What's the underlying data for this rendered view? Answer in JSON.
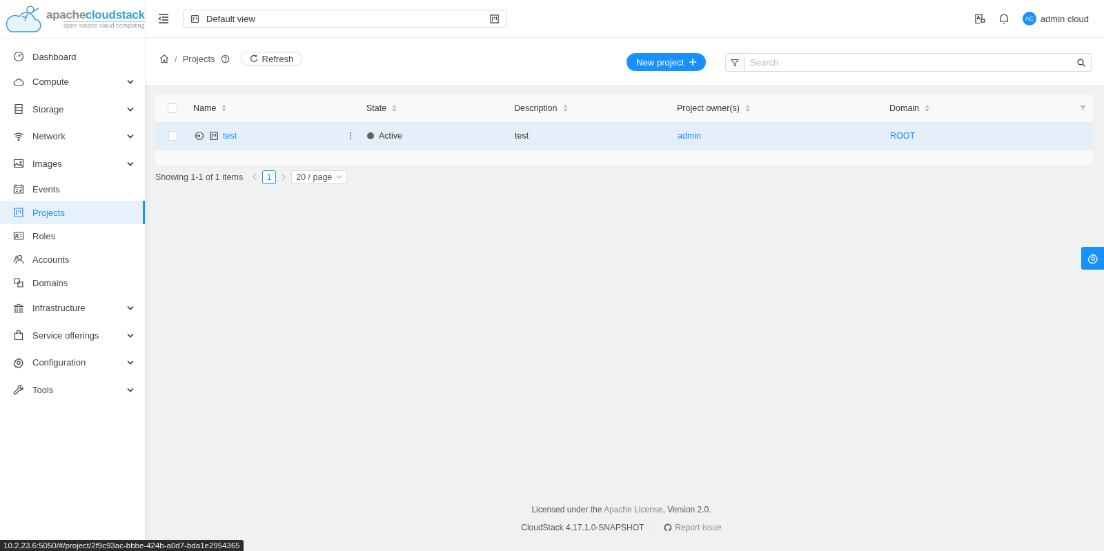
{
  "logo": {
    "prefix": "apache",
    "suffix": "cloudstack",
    "tagline": "open source cloud computing"
  },
  "header": {
    "view_selector": "Default view",
    "user_initials": "AC",
    "user_name": "admin cloud"
  },
  "sidebar": {
    "items": [
      {
        "label": "Dashboard",
        "expandable": false,
        "selected": false
      },
      {
        "label": "Compute",
        "expandable": true,
        "selected": false
      },
      {
        "label": "Storage",
        "expandable": true,
        "selected": false
      },
      {
        "label": "Network",
        "expandable": true,
        "selected": false
      },
      {
        "label": "Images",
        "expandable": true,
        "selected": false
      },
      {
        "label": "Events",
        "expandable": false,
        "selected": false
      },
      {
        "label": "Projects",
        "expandable": false,
        "selected": true
      },
      {
        "label": "Roles",
        "expandable": false,
        "selected": false
      },
      {
        "label": "Accounts",
        "expandable": false,
        "selected": false
      },
      {
        "label": "Domains",
        "expandable": false,
        "selected": false
      },
      {
        "label": "Infrastructure",
        "expandable": true,
        "selected": false
      },
      {
        "label": "Service offerings",
        "expandable": true,
        "selected": false
      },
      {
        "label": "Configuration",
        "expandable": true,
        "selected": false
      },
      {
        "label": "Tools",
        "expandable": true,
        "selected": false
      }
    ]
  },
  "breadcrumb": {
    "separator": "/",
    "current": "Projects"
  },
  "refresh_button": "Refresh",
  "new_project_button": "New project",
  "search": {
    "placeholder": "Search"
  },
  "table": {
    "select_all_checked": false,
    "columns": [
      "Name",
      "State",
      "Description",
      "Project owner(s)",
      "Domain"
    ],
    "rows": [
      {
        "name": "test",
        "state": "Active",
        "description": "test",
        "owner": "admin",
        "domain": "ROOT",
        "checked": false,
        "hovered": true
      }
    ]
  },
  "pagination": {
    "summary": "Showing 1-1 of 1 items",
    "pages": [
      {
        "label": "1",
        "selected": true
      }
    ],
    "page_size": "20 / page"
  },
  "footer": {
    "license_before": "Licensed under the ",
    "license_link": "Apache License",
    "license_after": ", Version 2.0.",
    "version": "CloudStack 4.17.1.0-SNAPSHOT",
    "report_issue": "Report issue"
  },
  "status_url": "10.2.23.6:5050/#/project/2f9c93ac-bbbe-424b-a0d7-bda1e2954365"
}
